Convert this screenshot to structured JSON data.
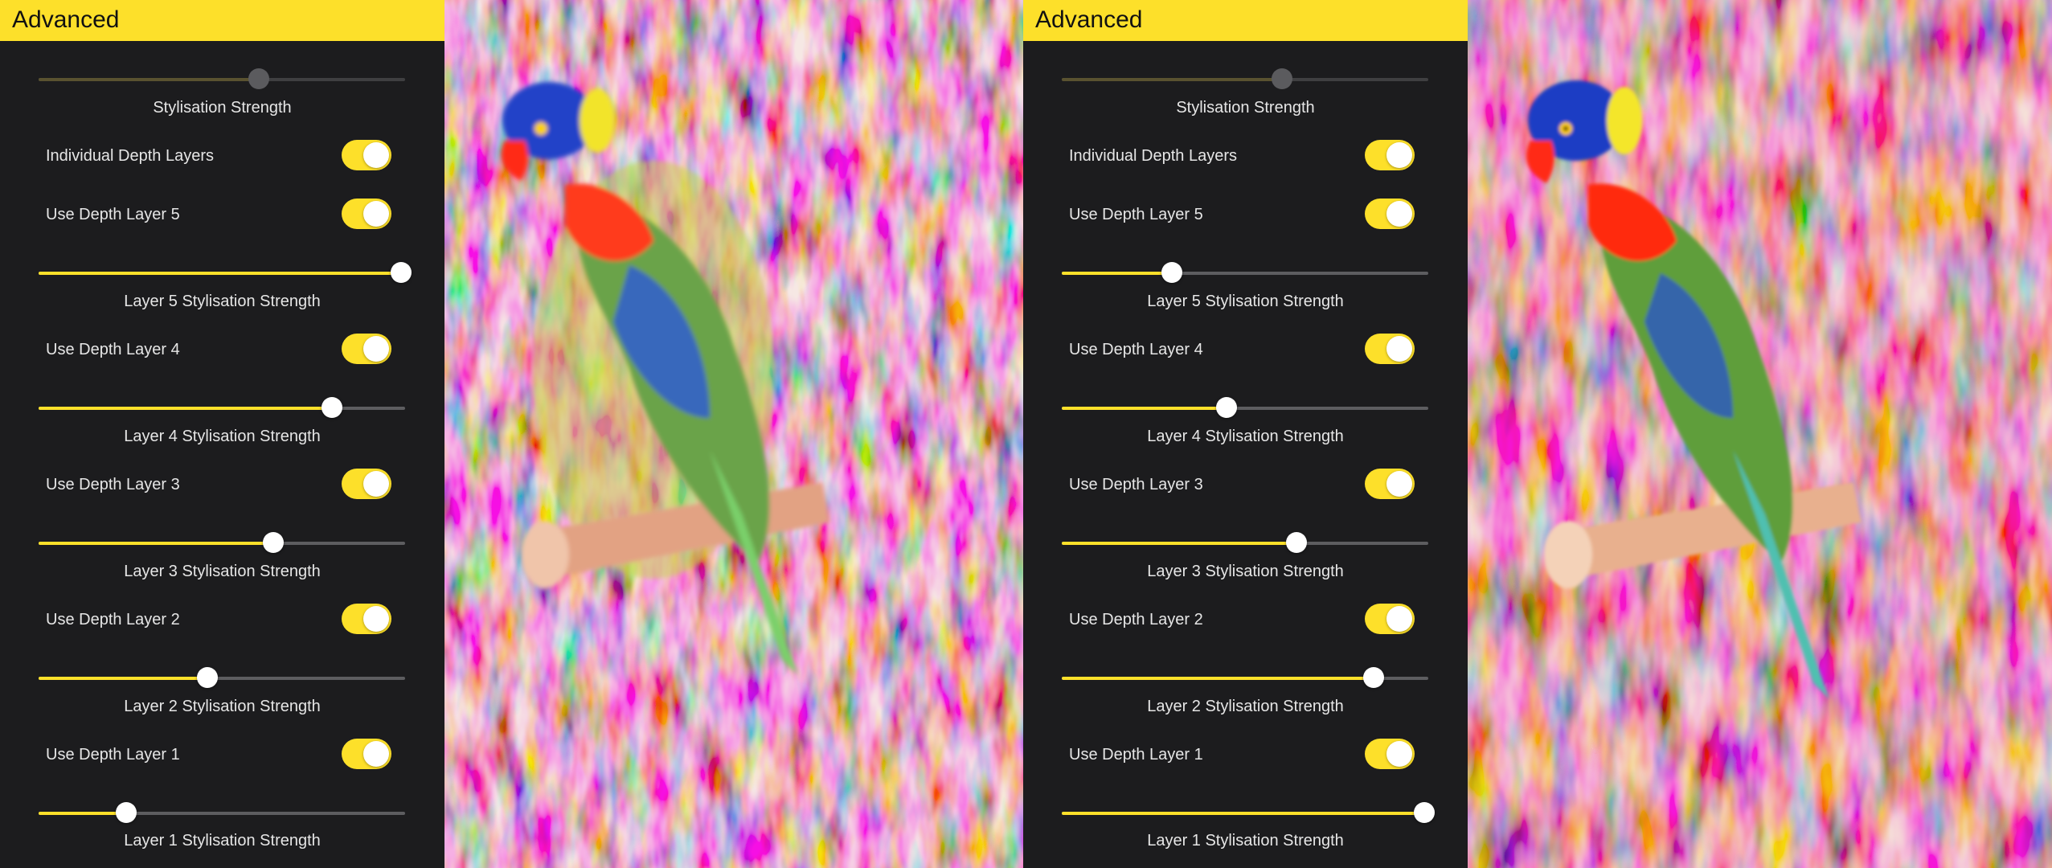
{
  "left_panel": {
    "header_title": "Advanced",
    "stylisation_strength": {
      "label": "Stylisation Strength",
      "value": 0.6,
      "enabled": false
    },
    "individual_depth_layers": {
      "label": "Individual Depth Layers",
      "on": true
    },
    "layers": [
      {
        "toggle_label": "Use Depth Layer 5",
        "on": true,
        "slider_label": "Layer 5 Stylisation Strength",
        "value": 0.99
      },
      {
        "toggle_label": "Use Depth Layer 4",
        "on": true,
        "slider_label": "Layer 4 Stylisation Strength",
        "value": 0.8
      },
      {
        "toggle_label": "Use Depth Layer 3",
        "on": true,
        "slider_label": "Layer 3 Stylisation Strength",
        "value": 0.64
      },
      {
        "toggle_label": "Use Depth Layer 2",
        "on": true,
        "slider_label": "Layer 2 Stylisation Strength",
        "value": 0.46
      },
      {
        "toggle_label": "Use Depth Layer 1",
        "on": true,
        "slider_label": "Layer 1 Stylisation Strength",
        "value": 0.24
      }
    ]
  },
  "right_panel": {
    "header_title": "Advanced",
    "stylisation_strength": {
      "label": "Stylisation Strength",
      "value": 0.6,
      "enabled": false
    },
    "individual_depth_layers": {
      "label": "Individual Depth Layers",
      "on": true
    },
    "layers": [
      {
        "toggle_label": "Use Depth Layer 5",
        "on": true,
        "slider_label": "Layer 5 Stylisation Strength",
        "value": 0.3
      },
      {
        "toggle_label": "Use Depth Layer 4",
        "on": true,
        "slider_label": "Layer 4 Stylisation Strength",
        "value": 0.45
      },
      {
        "toggle_label": "Use Depth Layer 3",
        "on": true,
        "slider_label": "Layer 3 Stylisation Strength",
        "value": 0.64
      },
      {
        "toggle_label": "Use Depth Layer 2",
        "on": true,
        "slider_label": "Layer 2 Stylisation Strength",
        "value": 0.85
      },
      {
        "toggle_label": "Use Depth Layer 1",
        "on": true,
        "slider_label": "Layer 1 Stylisation Strength",
        "value": 0.99
      }
    ]
  },
  "colors": {
    "accent": "#fde02a",
    "panel_background": "#1c1c1e",
    "track_inactive": "#5d5d60",
    "text": "#e6e6e6"
  },
  "images": {
    "left": {
      "name": "stylised-parrot-image"
    },
    "right": {
      "name": "stylised-parrot-image"
    }
  }
}
